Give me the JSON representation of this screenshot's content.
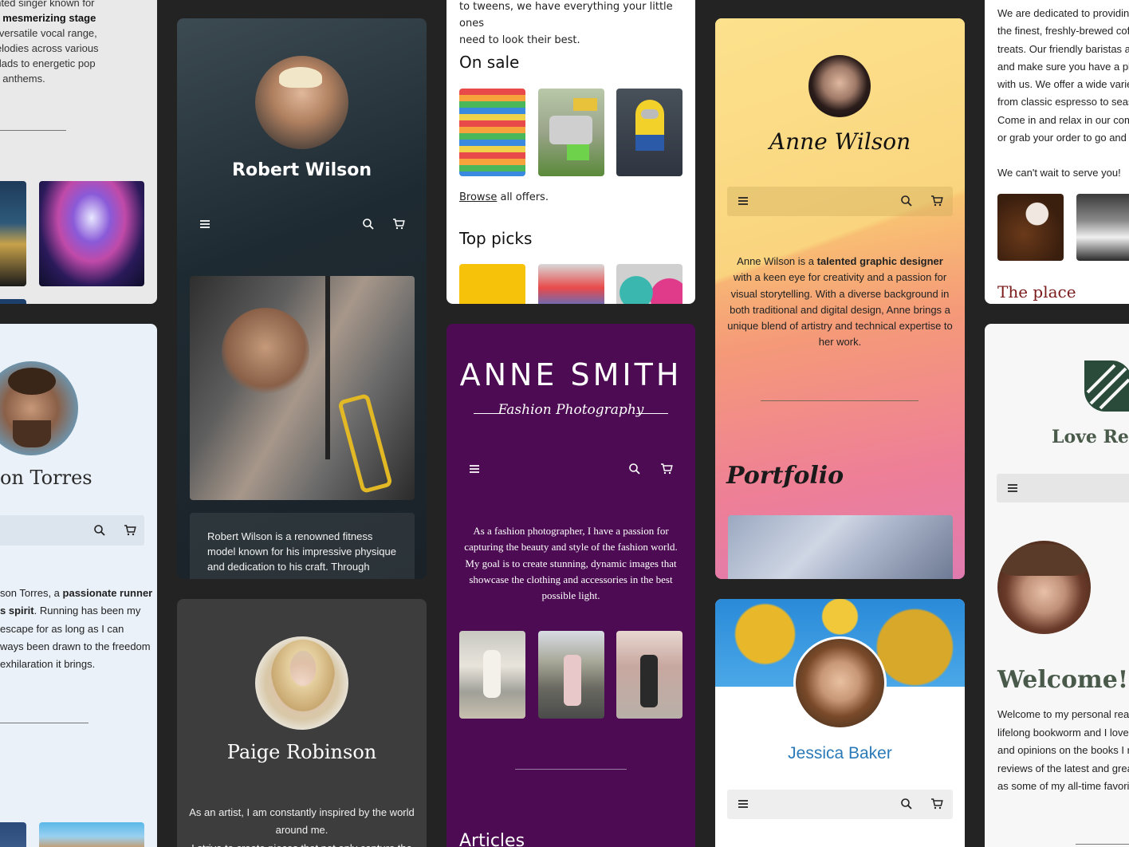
{
  "singer": {
    "bio_line1": "r is a talented singer known for",
    "bio_line2": "voice and mesmerizing stage",
    "bio_line3": "a rich and versatile vocal range,",
    "bio_line4": "weaves melodies across various",
    "bio_line5": "soulful ballads to energetic pop",
    "bio_line6": "anthems."
  },
  "robert": {
    "name": "Robert Wilson",
    "bio_line1": "Robert Wilson is a renowned fitness",
    "bio_line2": "model known for his impressive physique",
    "bio_line3": "and dedication to his craft. Through"
  },
  "shop": {
    "intro_line1": "to tweens, we have everything your little ones",
    "intro_line2": "need to look their best.",
    "on_sale_heading": "On sale",
    "browse_link": "Browse",
    "browse_rest": " all offers.",
    "top_picks_heading": "Top picks"
  },
  "anne_wilson": {
    "name": "Anne Wilson",
    "bio_pre": "Anne Wilson is a ",
    "bio_bold": "talented graphic designer",
    "bio_post": " with a keen eye for creativity and a passion for visual storytelling. With a diverse background in both traditional and digital design, Anne brings a unique blend of artistry and technical expertise to her work.",
    "portfolio_heading": "Portfolio"
  },
  "coffee": {
    "text_line1": "We are dedicated to providing",
    "text_line2": "the finest, freshly-brewed coffe",
    "text_line3": "treats. Our friendly baristas ar",
    "text_line4": "and make sure you have a ple",
    "text_line5": "with us. We offer a wide variet",
    "text_line6": "from classic espresso to seas",
    "text_line7": "Come in and relax in our comf",
    "text_line8": "or grab your order to go and e",
    "text_line9": "We can't wait to serve you!",
    "place_heading": "The place"
  },
  "torres": {
    "name": "on Torres",
    "line1_pre": "son Torres, a ",
    "line1_bold": "passionate runner",
    "line2_bold": "s spirit",
    "line2_post": ". Running has been my",
    "line3": " escape for as long as I can",
    "line4": "ways been drawn to the freedom",
    "line5": "exhilaration it brings."
  },
  "paige": {
    "name": "Paige Robinson",
    "bio_line1": "As an artist, I am constantly inspired by the world",
    "bio_line2": "around me.",
    "bio_line3": "I strive to create pieces that not only capture the"
  },
  "anne_smith": {
    "name": "ANNE SMITH",
    "tagline": "Fashion Photography",
    "bio": "As a fashion photographer, I have a passion for capturing the beauty and style of the fashion world. My goal is to create stunning, dynamic images that showcase the clothing and accessories in the best possible light.",
    "articles_heading": "Articles"
  },
  "jessica": {
    "name": "Jessica Baker"
  },
  "love_reading": {
    "title": "Love Rea",
    "welcome": "Welcome!",
    "line1": "Welcome to my personal read",
    "line2": "lifelong bookworm and I love s",
    "line3": "and opinions on the books I re",
    "line4": "reviews of the latest and great",
    "line5": "as some of my all-time favorite"
  },
  "icons": [
    "menu-icon",
    "search-icon",
    "cart-icon"
  ]
}
